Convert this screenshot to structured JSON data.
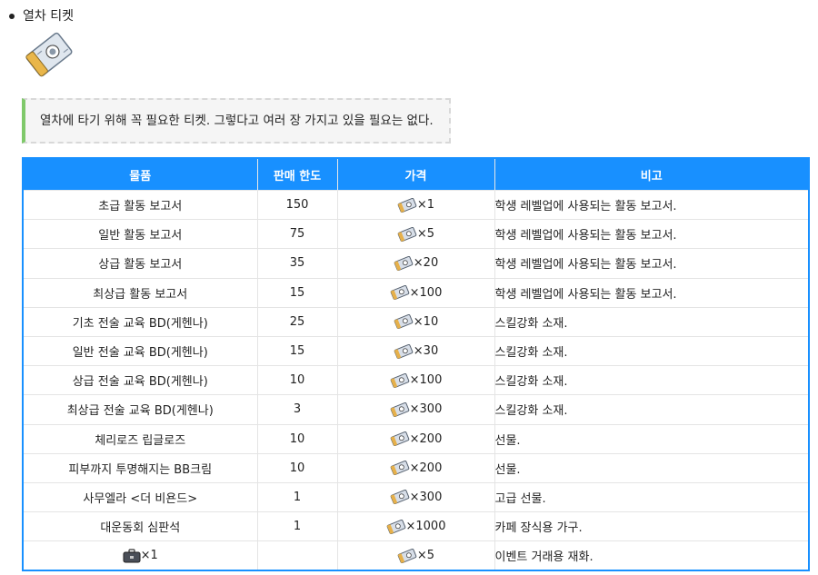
{
  "header": {
    "bullet_title": "열차 티켓",
    "ticket_icon": "train-ticket-icon",
    "description": "열차에 타기 위해 꼭 필요한 티켓. 그렇다고 여러 장 가지고 있을 필요는 없다."
  },
  "table": {
    "columns": [
      "물품",
      "판매 한도",
      "가격",
      "비고"
    ],
    "currency_icon": "train-ticket-currency-icon",
    "rows": [
      {
        "item": "초급 활동 보고서",
        "limit": "150",
        "price": "×1",
        "note": "학생 레벨업에 사용되는 활동 보고서."
      },
      {
        "item": "일반 활동 보고서",
        "limit": "75",
        "price": "×5",
        "note": "학생 레벨업에 사용되는 활동 보고서."
      },
      {
        "item": "상급 활동 보고서",
        "limit": "35",
        "price": "×20",
        "note": "학생 레벨업에 사용되는 활동 보고서."
      },
      {
        "item": "최상급 활동 보고서",
        "limit": "15",
        "price": "×100",
        "note": "학생 레벨업에 사용되는 활동 보고서."
      },
      {
        "item": "기초 전술 교육 BD(게헨나)",
        "limit": "25",
        "price": "×10",
        "note": "스킬강화 소재."
      },
      {
        "item": "일반 전술 교육 BD(게헨나)",
        "limit": "15",
        "price": "×30",
        "note": "스킬강화 소재."
      },
      {
        "item": "상급 전술 교육 BD(게헨나)",
        "limit": "10",
        "price": "×100",
        "note": "스킬강화 소재."
      },
      {
        "item": "최상급 전술 교육 BD(게헨나)",
        "limit": "3",
        "price": "×300",
        "note": "스킬강화 소재."
      },
      {
        "item": "체리로즈 립글로즈",
        "limit": "10",
        "price": "×200",
        "note": "선물."
      },
      {
        "item": "피부까지 투명해지는 BB크림",
        "limit": "10",
        "price": "×200",
        "note": "선물."
      },
      {
        "item": "사무엘라 <더 비욘드>",
        "limit": "1",
        "price": "×300",
        "note": "고급 선물."
      },
      {
        "item": "대운동회 심판석",
        "limit": "1",
        "price": "×1000",
        "note": "카페 장식용 가구."
      },
      {
        "item": "×1",
        "item_icon": "briefcase-icon",
        "limit": "",
        "price": "×5",
        "note": "이벤트 거래용 재화."
      }
    ]
  }
}
